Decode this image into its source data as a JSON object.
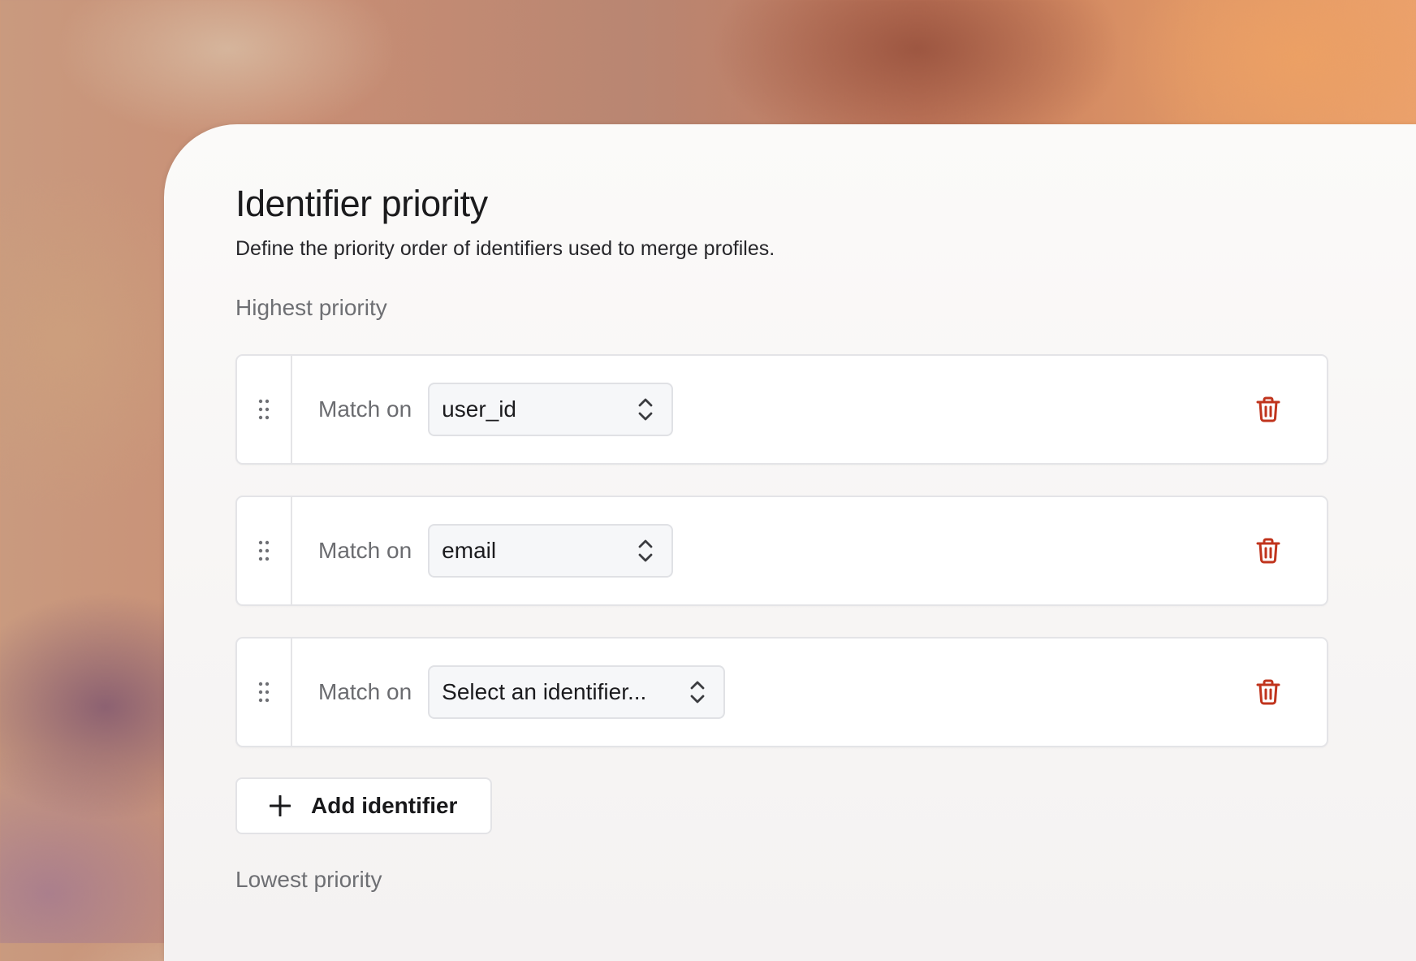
{
  "panel": {
    "title": "Identifier priority",
    "subtitle": "Define the priority order of identifiers used to merge profiles.",
    "highest_label": "Highest priority",
    "lowest_label": "Lowest priority"
  },
  "rows": [
    {
      "match_label": "Match on",
      "select_value": "user_id",
      "is_placeholder": false
    },
    {
      "match_label": "Match on",
      "select_value": "email",
      "is_placeholder": false
    },
    {
      "match_label": "Match on",
      "select_value": "Select an identifier...",
      "is_placeholder": true
    }
  ],
  "add_button": {
    "label": "Add identifier"
  },
  "icons": {
    "drag_handle": "drag-handle-icon",
    "select_chevrons": "chevron-up-down-icon",
    "delete": "trash-icon",
    "add": "plus-icon"
  },
  "colors": {
    "delete_icon": "#c0341d",
    "text_primary": "#1b1b1d",
    "text_secondary": "#6e6f73",
    "row_border": "#e4e4e7",
    "panel_bg": "#fbfaf9"
  }
}
